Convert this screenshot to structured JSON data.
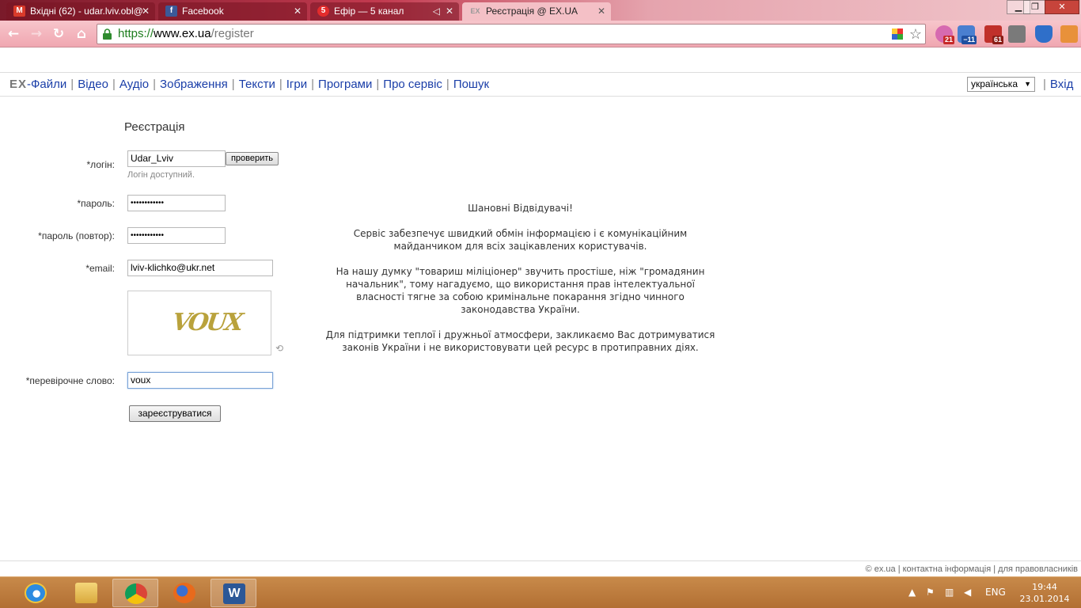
{
  "browser": {
    "tabs": [
      {
        "title": "Вхідні (62) - udar.lviv.obl@",
        "icon": "gmail-icon",
        "active": false
      },
      {
        "title": "Facebook",
        "icon": "facebook-icon",
        "active": false
      },
      {
        "title": "Ефір — 5 канал",
        "icon": "channel5-icon",
        "active": false
      },
      {
        "title": "Реєстрація @ EX.UA",
        "icon": "exua-icon",
        "active": true
      }
    ],
    "favicon_labels": {
      "gmail": "M",
      "facebook": "f",
      "channel5": "5",
      "exua": "EX"
    },
    "url": {
      "scheme": "https://",
      "host": "www.ex.ua",
      "path": "/register"
    },
    "extensions": [
      {
        "name": "weather-extension",
        "badge": "21"
      },
      {
        "name": "forecast-extension",
        "badge": "−11"
      },
      {
        "name": "gmail-checker-extension",
        "badge": "61"
      }
    ],
    "window_controls": {
      "minimize": "▁",
      "maximize": "❐",
      "close": "✕"
    }
  },
  "nav": {
    "logo_text": "EX",
    "items": [
      "-Файли",
      "Відео",
      "Аудіо",
      "Зображення",
      "Тексти",
      "Ігри",
      "Програми",
      "Про сервіс",
      "Пошук"
    ],
    "language": "українська",
    "login": "Вхід"
  },
  "form": {
    "title": "Реєстрація",
    "login_label": "*логін:",
    "login_value": "Udar_Lviv",
    "check_button": "проверить",
    "login_status": "Логін доступний.",
    "password_label": "*пароль:",
    "password_value": "••••••••••••",
    "password_repeat_label": "*пароль (повтор):",
    "password_repeat_value": "••••••••••••",
    "email_label": "*email:",
    "email_value": "lviv-klichko@ukr.net",
    "captcha_text": "VOUX",
    "captcha_word_label": "*перевірочне слово:",
    "captcha_word_value": "voux",
    "submit_button": "зареєструватися"
  },
  "notice": {
    "greeting": "Шановні Відвідувачі!",
    "paragraphs": [
      "Сервіс забезпечує швидкий обмін інформацією і є комунікаційним майданчиком для всіх зацікавлених користувачів.",
      "На нашу думку \"товариш міліціонер\" звучить простіше, ніж \"громадянин начальник\", тому нагадуємо, що використання прав інтелектуальної власності тягне за собою кримінальне покарання згідно чинного законодавства України.",
      "Для підтримки теплої і дружньої атмосфери, закликаємо Вас дотримуватися законів України і не використовувати цей ресурс в протиправних діях."
    ]
  },
  "footer": {
    "copyright": "© ex.ua",
    "contact": "контактна інформація",
    "rights": "для правовласників"
  },
  "taskbar": {
    "apps": [
      "internet-explorer",
      "file-explorer",
      "chrome",
      "firefox",
      "word"
    ],
    "running": [
      "chrome",
      "word"
    ],
    "tray": {
      "language": "ENG",
      "time": "19:44",
      "date": "23.01.2014"
    }
  },
  "colors": {
    "link": "#1a3ea8",
    "secure_green": "#1e7d1e",
    "taskbar": "#b26f33"
  }
}
